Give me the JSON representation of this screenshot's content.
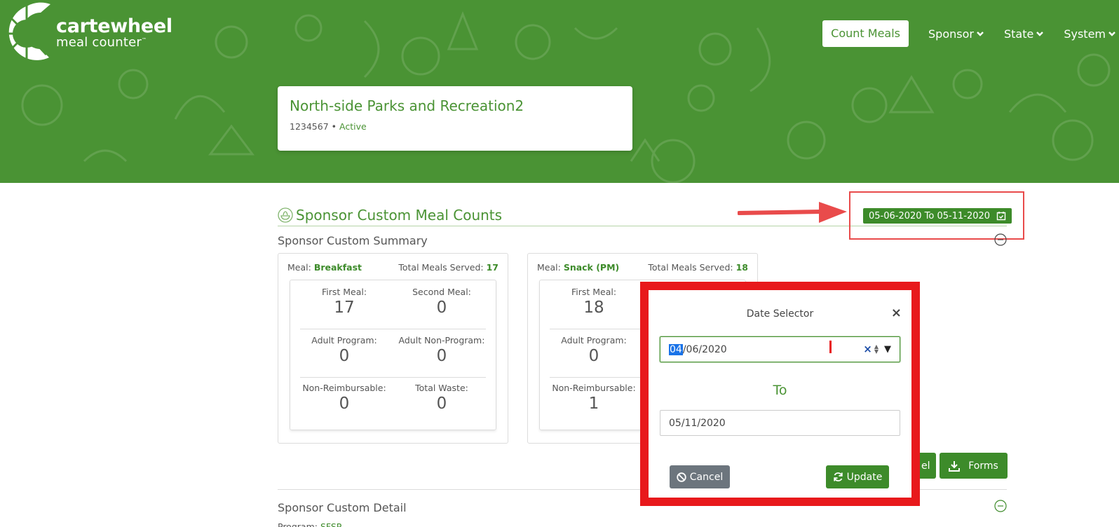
{
  "brand": {
    "name": "cartewheel",
    "tagline": "meal counter",
    "tm": "™"
  },
  "nav": {
    "active": "Count Meals",
    "items": [
      "Sponsor",
      "State",
      "System"
    ]
  },
  "org": {
    "name": "North-side Parks and Recreation2",
    "id": "1234567",
    "separator": " • ",
    "status": "Active"
  },
  "section": {
    "title": "Sponsor Custom Meal Counts",
    "date_range": "05-06-2020 To 05-11-2020",
    "summary_title": "Sponsor Custom Summary",
    "detail_title": "Sponsor Custom Detail",
    "program_label": "Program:",
    "program_value": "SFSP"
  },
  "meal_cards": [
    {
      "meal_label": "Meal:",
      "meal": "Breakfast",
      "total_label": "Total Meals Served:",
      "total": "17",
      "stats": [
        {
          "label": "First Meal:",
          "value": "17"
        },
        {
          "label": "Second Meal:",
          "value": "0"
        },
        {
          "label": "Adult Program:",
          "value": "0"
        },
        {
          "label": "Adult Non-Program:",
          "value": "0"
        },
        {
          "label": "Non-Reimbursable:",
          "value": "0"
        },
        {
          "label": "Total Waste:",
          "value": "0"
        }
      ]
    },
    {
      "meal_label": "Meal:",
      "meal": "Snack (PM)",
      "total_label": "Total Meals Served:",
      "total": "18",
      "stats": [
        {
          "label": "First Meal:",
          "value": "18"
        },
        {
          "label": "Adult Program:",
          "value": "0"
        },
        {
          "label": "Non-Reimbursable:",
          "value": "1"
        }
      ]
    }
  ],
  "actions": {
    "excel_partial": "el",
    "forms": "Forms"
  },
  "modal": {
    "title": "Date Selector",
    "close": "×",
    "from_month": "04",
    "from_rest": "/06/2020",
    "to_label": "To",
    "to_value": "05/11/2020",
    "cancel": "Cancel",
    "update": "Update"
  },
  "colors": {
    "brand_green": "#4a9334",
    "button_green": "#3d8b2a",
    "highlight_red": "#e8191c",
    "cancel_gray": "#6c757d"
  },
  "icons": [
    "calendar-check-icon",
    "salad-bowl-icon",
    "collapse-minus-icon",
    "chevron-down-icon",
    "download-icon",
    "ban-icon",
    "refresh-icon",
    "close-icon"
  ]
}
